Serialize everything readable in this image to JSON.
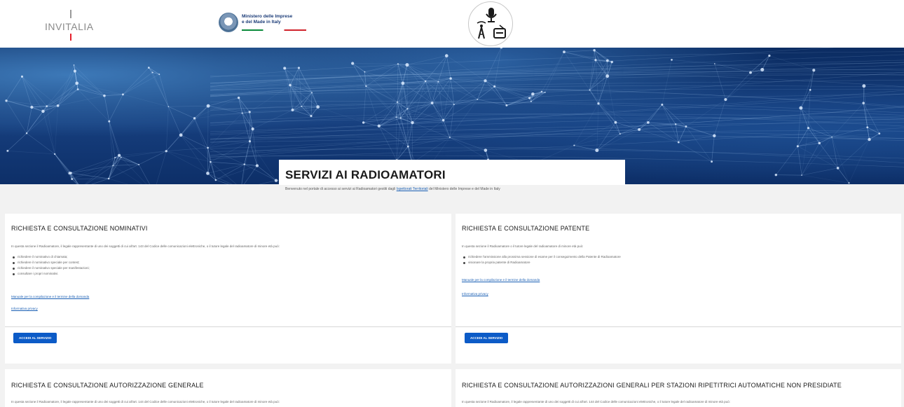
{
  "header": {
    "invitalia_logo": "INVITALIA",
    "ministry_logo": [
      "Ministero delle Imprese",
      "e del Made in Italy"
    ]
  },
  "hero": {
    "title": "SERVIZI AI RADIOAMATORI",
    "welcome_pre": "Benvenuto nel portale di accesso ai servizi ai Radioamatori gestiti dagli ",
    "welcome_link": "Ispettorati Territoriali",
    "welcome_post": " del Ministero delle Imprese e del Made in Italy"
  },
  "cards": [
    {
      "title": "RICHIESTA E CONSULTAZIONE NOMINATIVI",
      "intro": "In questa sezione il Radioamatore, il legale rappresentante di uno dei soggetti di cui all'art. 143 del Codice delle comunicazioni elettroniche, o il tutore legale del radioamatore di minore età può:",
      "items": [
        "richiedere il nominativo di chiamata;",
        "richiedere il nominativo speciale per contest;",
        "richiedere il nominativo speciale per manifestazioni;",
        "consultare i propri nominativi."
      ],
      "links": [
        "Manuale per la compilazione e il termine della domanda",
        "Informativa privacy"
      ],
      "button": "ACCEDI AL SERVIZIO"
    },
    {
      "title": "RICHIESTA E CONSULTAZIONE PATENTE",
      "intro": "In questa sezione il Radioamatore o il tutore legale del radioamatore di minore età può:",
      "items": [
        "richiedere l'ammissione alla prossima sessione di esame per il conseguimento della Patente di Radioamatore",
        "visionare la propria patente di Radioamatore"
      ],
      "links": [
        "Manuale per la compilazione e il termine della domanda",
        "Informativa privacy"
      ],
      "button": "ACCEDI AL SERVIZIO"
    },
    {
      "title": "RICHIESTA E CONSULTAZIONE AUTORIZZAZIONE GENERALE",
      "intro": "In questa sezione il Radioamatore, il legale rappresentante di uno dei soggetti di cui all'art. 144 del Codice delle comunicazioni elettroniche, o il tutore legale del radioamatore di minore età può:"
    },
    {
      "title": "RICHIESTA E CONSULTAZIONE AUTORIZZAZIONI GENERALI PER STAZIONI RIPETITRICI AUTOMATICHE NON PRESIDIATE",
      "intro": "In questa sezione il Radioamatore, il legale rappresentante di uno dei soggetti di cui all'art. 144 del Codice delle comunicazioni elettroniche, o il tutore legale del radioamatore di minore età può:"
    }
  ],
  "colors": {
    "button": "#0c5bc7",
    "link": "#1a5fb4",
    "hero_dark": "#0b2c62"
  }
}
